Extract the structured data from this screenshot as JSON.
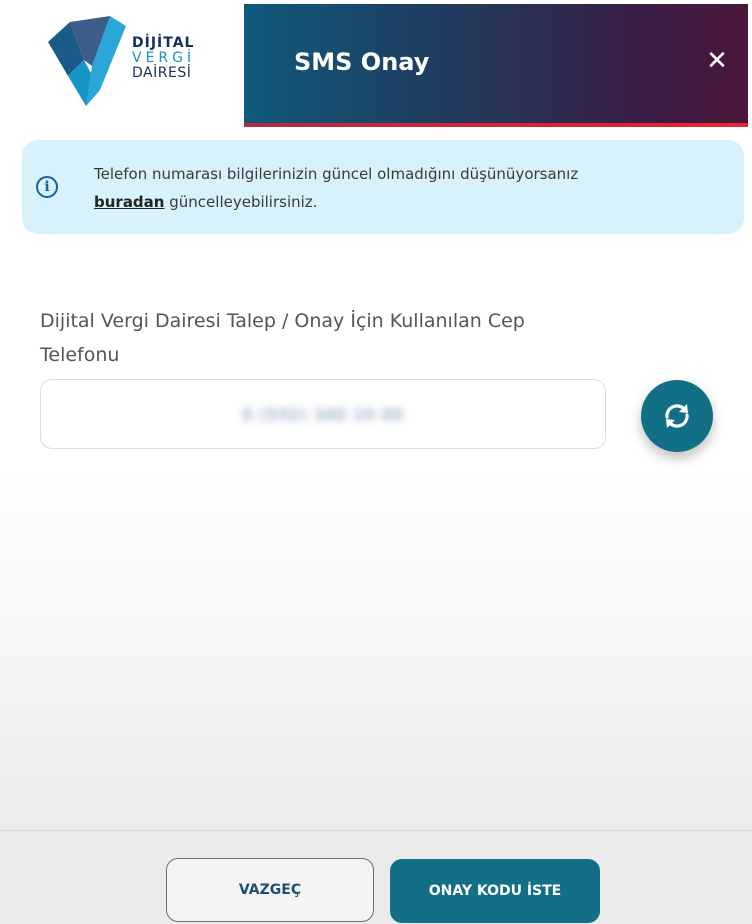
{
  "header": {
    "logo": {
      "line1": "DİJİTAL",
      "line2": "VERGİ",
      "line3": "DAİRESİ"
    },
    "title": "SMS Onay",
    "close_label": "✕",
    "accent_colors": {
      "primary": "#126f86",
      "header_end": "#4b1639",
      "stripe": "#d9242d"
    }
  },
  "alert": {
    "icon": "info-icon",
    "text_before": "Telefon numarası bilgilerinizin güncel olmadığını düşünüyorsanız",
    "link_text": "buradan",
    "text_after": "güncelleyebilirsiniz."
  },
  "phone": {
    "label": "Dijital Vergi Dairesi Talep / Onay İçin Kullanılan Cep Telefonu",
    "value": "0 (532) 340 10 00",
    "refresh_icon": "refresh-icon"
  },
  "footer": {
    "cancel_label": "VAZGEÇ",
    "submit_label": "ONAY KODU İSTE"
  }
}
